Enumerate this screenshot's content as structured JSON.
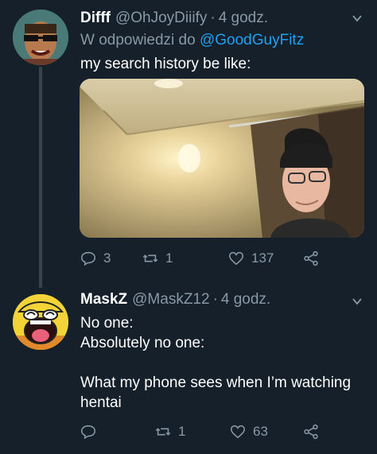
{
  "tweets": [
    {
      "display_name": "Difff",
      "handle": "@OhJoyDiiify",
      "separator": "·",
      "time": "4 godz.",
      "reply_prefix": "W odpowiedzi do",
      "reply_to": "@GoodGuyFitz",
      "text": "my search history be like:",
      "actions": {
        "replies": "3",
        "retweets": "1",
        "likes": "137"
      }
    },
    {
      "display_name": "MaskZ",
      "handle": "@MaskZ12",
      "separator": "·",
      "time": "4 godz.",
      "text_lines": [
        "No one:",
        "Absolutely no one:",
        "",
        "What my phone sees when I’m watching hentai"
      ],
      "actions": {
        "replies": "",
        "retweets": "1",
        "likes": "63"
      }
    }
  ],
  "icons": {
    "reply": "reply-icon",
    "retweet": "retweet-icon",
    "like": "heart-icon",
    "share": "share-icon",
    "more": "chevron-down-icon"
  },
  "colors": {
    "background": "#15202b",
    "secondary_text": "#8899a6",
    "link": "#1da1f2",
    "thread_line": "#38444d"
  }
}
